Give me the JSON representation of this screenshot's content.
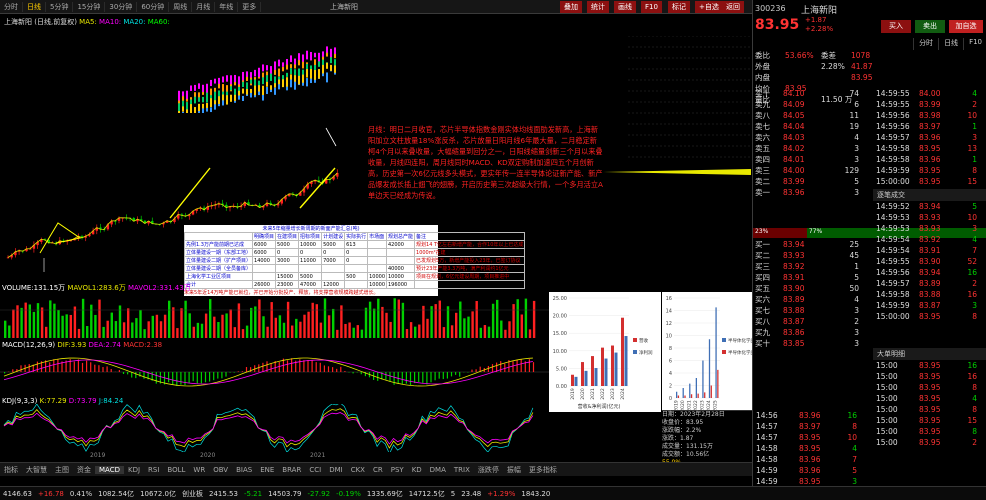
{
  "toolbar": {
    "items": [
      "分时",
      "日线",
      "5分钟",
      "15分钟",
      "30分钟",
      "60分钟",
      "周线",
      "月线",
      "年线",
      "更多"
    ],
    "active": "日线",
    "ctl": [
      "叠加",
      "统计",
      "画线",
      "F10",
      "标记",
      "+自选",
      "返回"
    ],
    "title": "上海新阳"
  },
  "chart_title": {
    "name": "上海新阳",
    "period": "(日线,前复权)",
    "ma_labels": [
      "MA5:",
      "MA10:",
      "MA20:",
      "MA60:"
    ]
  },
  "note": "月线：明日二月收官，芯片半导体指数金刚实体均线面肋发新高，上海新阳加立文柱放量18%涨反杀，芯片放量日阳月线6年最大量，二月稳定新柯4个月以来叠收量，大幅缩量到回分之一，日阳线缩量剑新三个月以来叠收量，月线四连阳，周月线同时MACD、KD双定购制加速四五个月创新高，历史第一次6亿元线多头模式，更实年传一连半导体论证新产能、新产品爆发成长插上翅飞的翅膀，开启历史第三次超级大行情，一个多月活立A单边天已经成为传说。",
  "table": {
    "title": "未来5年缩量增长新周期的新面产能汇总(吨)",
    "head": [
      "",
      "明确项目",
      "在建项目",
      "招标项目",
      "计划建设",
      "实际执行",
      "市场面",
      "规划总产能",
      "备注"
    ],
    "rows": [
      [
        "先例1.3万产能前期已达成",
        "6000",
        "5000",
        "10000",
        "5000",
        "613",
        "",
        "42000",
        "规划14 T亿左右新增产能，合作10年以上已达成"
      ],
      [
        "立体量建设一期（东部工地）",
        "6000",
        "0",
        "0",
        "0",
        "0",
        "",
        "",
        "1000m²在建"
      ],
      [
        "立体量建设二期（扩产项目）",
        "14000",
        "3000",
        "11000",
        "7000",
        "0",
        "",
        "",
        "已发规划5万，新增产能投入23年，已签订协议"
      ],
      [
        "立体量建设二期（全员备库）",
        "",
        "",
        "",
        "",
        "",
        "",
        "40000",
        "预计23年产能3.3万吨，满产利润约1亿元"
      ],
      [
        "上海化学工业区项目",
        "",
        "15000",
        "5000",
        "",
        "500",
        "10000",
        "10000",
        "项目在规划，6亿元建设周期，项目推进中"
      ],
      [
        "合计",
        "26000",
        "23000",
        "47000",
        "12000",
        "",
        "10000",
        "196000",
        ""
      ]
    ],
    "foot": "未来5年近14万吨产能已就位，并已开始分批投产、释放，将支撑营收规模跨越式增长。"
  },
  "volume_lbl": {
    "name": "VOLUME:",
    "vals": [
      "VOLUME:131.15万",
      "MAVOL1:283.6万",
      "MAVOL2:331.43万"
    ]
  },
  "macd_lbl": {
    "vals": [
      "MACD(12,26,9)",
      "DIF:3.93",
      "DEA:2.74",
      "MACD:2.38"
    ]
  },
  "kdj_lbl": {
    "vals": [
      "KDJ(9,3,3)",
      "K:77.29",
      "D:73.79",
      "J:84.24"
    ]
  },
  "xaxis": [
    "2019",
    "2020",
    "2021"
  ],
  "chart1": {
    "title": "营收及净利润(亿元)",
    "type": "bar",
    "categories": [
      "2019",
      "2020",
      "2021",
      "2022",
      "2023",
      "2024"
    ],
    "series": [
      {
        "name": "营收",
        "values": [
          3.2,
          6.8,
          8.5,
          10.9,
          11.5,
          19.4
        ]
      },
      {
        "name": "净利润",
        "values": [
          2.6,
          4.3,
          5.1,
          7.8,
          9.5,
          14.2
        ]
      }
    ],
    "ylim": [
      0,
      25
    ],
    "yticks": [
      "25.00",
      "20.00",
      "15.00",
      "10.00",
      "5.00",
      "0.00"
    ],
    "legend": [
      "营收",
      "净利润"
    ],
    "xlabel": "营收&净利润(亿元)"
  },
  "chart2": {
    "title": "",
    "type": "bar",
    "categories": [
      "2019",
      "2020",
      "2021",
      "2022",
      "2023",
      "2024",
      "2025"
    ],
    "series": [
      {
        "name": "半导体化学品营收(亿元)",
        "values": [
          1.0,
          1.6,
          2.3,
          3.2,
          6.0,
          9.4,
          14.5
        ]
      },
      {
        "name": "半导体化学品产量(万吨)",
        "values": [
          0.4,
          0.4,
          0.6,
          0.7,
          0.9,
          2.0,
          4.5
        ]
      }
    ],
    "ylim": [
      0,
      16
    ],
    "yticks": [
      "16",
      "14",
      "12",
      "10",
      "8",
      "6",
      "4",
      "2",
      "0"
    ],
    "legend": [
      "半导体化学品营收(亿元)",
      "半导体化学品产量(万吨)"
    ]
  },
  "smallinfo": {
    "lines": [
      "日期：2023年2月28日",
      "收盘价：83.95",
      "涨跌幅：2.2%",
      "涨跌：1.87",
      "成交量：131.15万",
      "成交额：10.56亿"
    ],
    "ratio": "55.0%"
  },
  "bottom_tabs": [
    "指标",
    "大智慧",
    "主图",
    "资金",
    "MACD",
    "KDJ",
    "RSI",
    "BOLL",
    "WR",
    "OBV",
    "BIAS",
    "ENE",
    "BRAR",
    "CCI",
    "DMI",
    "CKX",
    "CR",
    "PSY",
    "KD",
    "DMA",
    "TRIX",
    "涨跌停",
    "振幅",
    "更多指标"
  ],
  "bottom_active": "MACD",
  "status": {
    "items": [
      "4146.63",
      "+16.78",
      "0.41%",
      "1082.54亿",
      "10672.0亿",
      "创业板",
      "2415.53",
      "-5.21",
      "14503.79",
      "-27.92",
      "-0.19%",
      "1335.69亿",
      "14712.5亿",
      "5",
      "23.48",
      "+1.29%",
      "1843.20"
    ]
  },
  "rp": {
    "code": "300236",
    "name": "上海新阳",
    "price": "83.95",
    "chg": "+1.87",
    "pct": "+2.28%",
    "btn1": "买入",
    "btn2": "卖出",
    "btn3": "加自选",
    "tabs": [
      "分时",
      "日线",
      "F10"
    ],
    "stats": [
      [
        "委比",
        "53.66%",
        "委差",
        "1078"
      ],
      [
        "外盘",
        "",
        "2.28%",
        "41.87"
      ],
      [
        "内盘",
        "",
        "",
        "83.95"
      ],
      [
        "均价",
        "83.95",
        "",
        ""
      ],
      [
        "量比",
        "",
        "11.50 万",
        ""
      ]
    ],
    "sell": [
      [
        "卖十",
        "84.10",
        "74"
      ],
      [
        "卖九",
        "84.09",
        "6"
      ],
      [
        "卖八",
        "84.05",
        "11"
      ],
      [
        "卖七",
        "84.04",
        "19"
      ],
      [
        "卖六",
        "84.03",
        "4"
      ],
      [
        "卖五",
        "84.02",
        "3"
      ],
      [
        "卖四",
        "84.01",
        "3"
      ],
      [
        "卖三",
        "84.00",
        "129"
      ],
      [
        "卖二",
        "83.99",
        "5"
      ],
      [
        "卖一",
        "83.96",
        "3"
      ]
    ],
    "buy": [
      [
        "买一",
        "83.94",
        "25"
      ],
      [
        "买二",
        "83.93",
        "45"
      ],
      [
        "买三",
        "83.92",
        "1"
      ],
      [
        "买四",
        "83.91",
        "5"
      ],
      [
        "买五",
        "83.90",
        "50"
      ],
      [
        "买六",
        "83.89",
        "4"
      ],
      [
        "买七",
        "83.88",
        "3"
      ],
      [
        "买八",
        "83.87",
        "2"
      ],
      [
        "买九",
        "83.86",
        "3"
      ],
      [
        "买十",
        "83.85",
        "3"
      ]
    ],
    "right_vals": [
      "83.95",
      "41.87",
      "82.00",
      "65.66",
      "84.89",
      "51612",
      "1.43%",
      "0.3%",
      "3.50亿",
      "263.1亿",
      "8.84"
    ],
    "ticks_title": "逐笔成交",
    "ticks": [
      [
        "14:59:55",
        "84.00",
        "4"
      ],
      [
        "14:59:55",
        "83.99",
        "2"
      ],
      [
        "14:59:56",
        "83.98",
        "10"
      ],
      [
        "14:59:56",
        "83.97",
        "1"
      ],
      [
        "14:59:57",
        "83.96",
        "3"
      ],
      [
        "14:59:58",
        "83.95",
        "13"
      ],
      [
        "14:59:58",
        "83.96",
        "1"
      ],
      [
        "14:59:59",
        "83.95",
        "8"
      ],
      [
        "15:00:00",
        "83.95",
        "15"
      ]
    ],
    "cmp": [
      "23%",
      "77%"
    ],
    "sell2_ticks": [
      [
        "14:59:52",
        "83.94",
        "5"
      ],
      [
        "14:59:53",
        "83.93",
        "10"
      ],
      [
        "14:59:53",
        "83.93",
        "3"
      ],
      [
        "14:59:54",
        "83.92",
        "4"
      ],
      [
        "14:59:54",
        "83.91",
        "7"
      ],
      [
        "14:59:55",
        "83.90",
        "52"
      ],
      [
        "14:59:56",
        "83.94",
        "16"
      ],
      [
        "14:59:57",
        "83.89",
        "2"
      ],
      [
        "14:59:58",
        "83.88",
        "16"
      ],
      [
        "14:59:59",
        "83.87",
        "3"
      ],
      [
        "15:00:00",
        "83.95",
        "8"
      ]
    ],
    "vol_lbl": "14:56",
    "vol": "4682",
    "big": "大单明细",
    "detail": [
      [
        "15:00",
        "83.95",
        "16"
      ],
      [
        "15:00",
        "83.95",
        "16"
      ],
      [
        "15:00",
        "83.95",
        "8"
      ],
      [
        "15:00",
        "83.95",
        "4"
      ],
      [
        "15:00",
        "83.95",
        "8"
      ],
      [
        "15:00",
        "83.95",
        "15"
      ],
      [
        "15:00",
        "83.95",
        "8"
      ],
      [
        "15:00",
        "83.95",
        "2"
      ]
    ],
    "lower": [
      [
        "14:56",
        "83.96",
        "16"
      ],
      [
        "14:57",
        "83.97",
        "8"
      ],
      [
        "14:57",
        "83.95",
        "10"
      ],
      [
        "14:58",
        "83.95",
        "4"
      ],
      [
        "14:58",
        "83.96",
        "7"
      ],
      [
        "14:59",
        "83.96",
        "5"
      ],
      [
        "14:59",
        "83.95",
        "3"
      ],
      [
        "15:00",
        "83.95",
        "10"
      ],
      [
        "15:00",
        "83.96",
        "3"
      ]
    ]
  }
}
